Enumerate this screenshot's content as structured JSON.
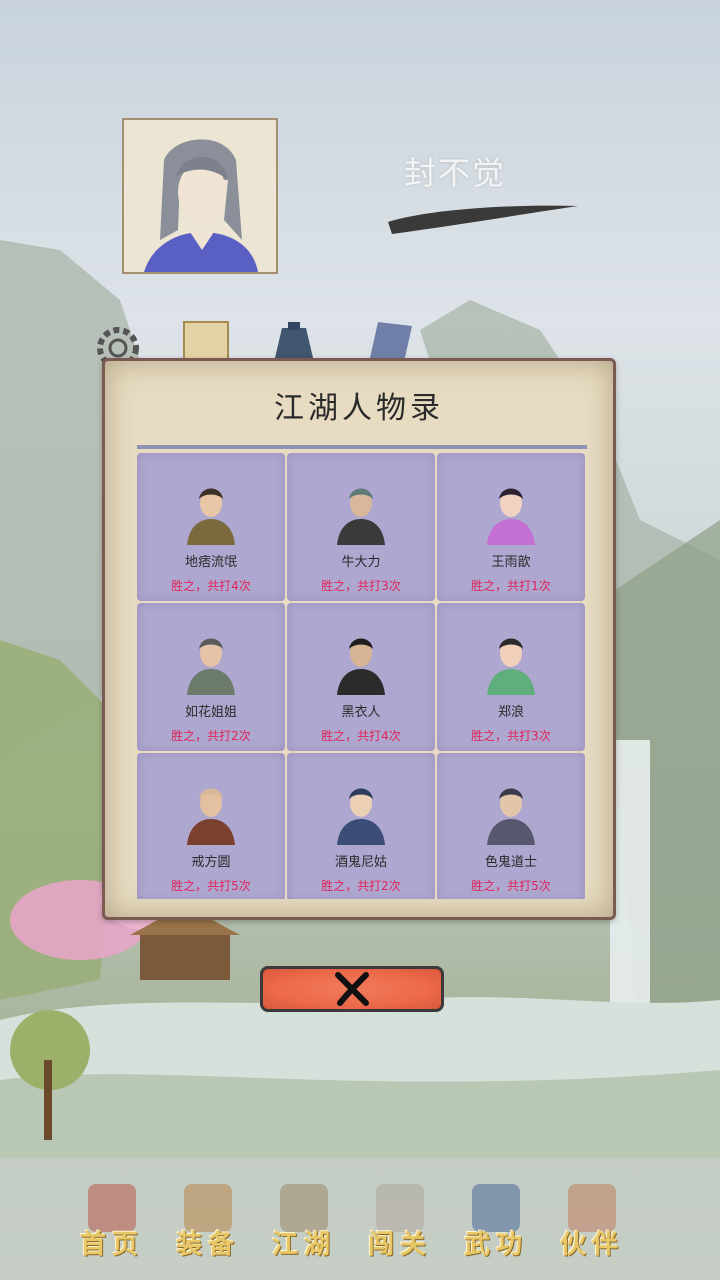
{
  "player": {
    "name": "封不觉"
  },
  "dialog": {
    "title": "江湖人物录",
    "characters": [
      {
        "name": "地痞流氓",
        "record": "胜之，共打4次",
        "hair": "#3b3326",
        "robe": "#7b6a3e",
        "skin": "#e7c7a5"
      },
      {
        "name": "牛大力",
        "record": "胜之，共打3次",
        "hair": "#5d7a76",
        "robe": "#3a3a3a",
        "skin": "#d9b79a"
      },
      {
        "name": "王雨歆",
        "record": "胜之，共打1次",
        "hair": "#2c2230",
        "robe": "#c46fd2",
        "skin": "#f0d2c0"
      },
      {
        "name": "如花姐姐",
        "record": "胜之，共打2次",
        "hair": "#5a5a5a",
        "robe": "#6b7a6b",
        "skin": "#e6c2a8"
      },
      {
        "name": "黑衣人",
        "record": "胜之，共打4次",
        "hair": "#1e1e1e",
        "robe": "#2b2b2b",
        "skin": "#d5b393"
      },
      {
        "name": "郑浪",
        "record": "胜之，共打3次",
        "hair": "#2a2a2a",
        "robe": "#5fae7c",
        "skin": "#f0d0b8"
      },
      {
        "name": "戒方圆",
        "record": "胜之，共打5次",
        "hair": "#d9b79a",
        "robe": "#7a4030",
        "skin": "#e3c0a0"
      },
      {
        "name": "酒鬼尼姑",
        "record": "胜之，共打2次",
        "hair": "#2c3c5a",
        "robe": "#3c4e78",
        "skin": "#ecd0b6"
      },
      {
        "name": "色鬼道士",
        "record": "胜之，共打5次",
        "hair": "#3a3a4a",
        "robe": "#57586e",
        "skin": "#e3c6aa"
      }
    ],
    "close_icon": "close-x-icon"
  },
  "top_icons": [
    "gear-icon",
    "scroll-icon",
    "bag-icon",
    "book-icon"
  ],
  "nav": [
    {
      "label": "首页",
      "icon": "home-gate-icon"
    },
    {
      "label": "装备",
      "icon": "armor-icon"
    },
    {
      "label": "江湖",
      "icon": "map-scroll-icon"
    },
    {
      "label": "闯关",
      "icon": "crossed-swords-icon"
    },
    {
      "label": "武功",
      "icon": "martial-book-icon"
    },
    {
      "label": "伙伴",
      "icon": "partners-icon"
    }
  ]
}
